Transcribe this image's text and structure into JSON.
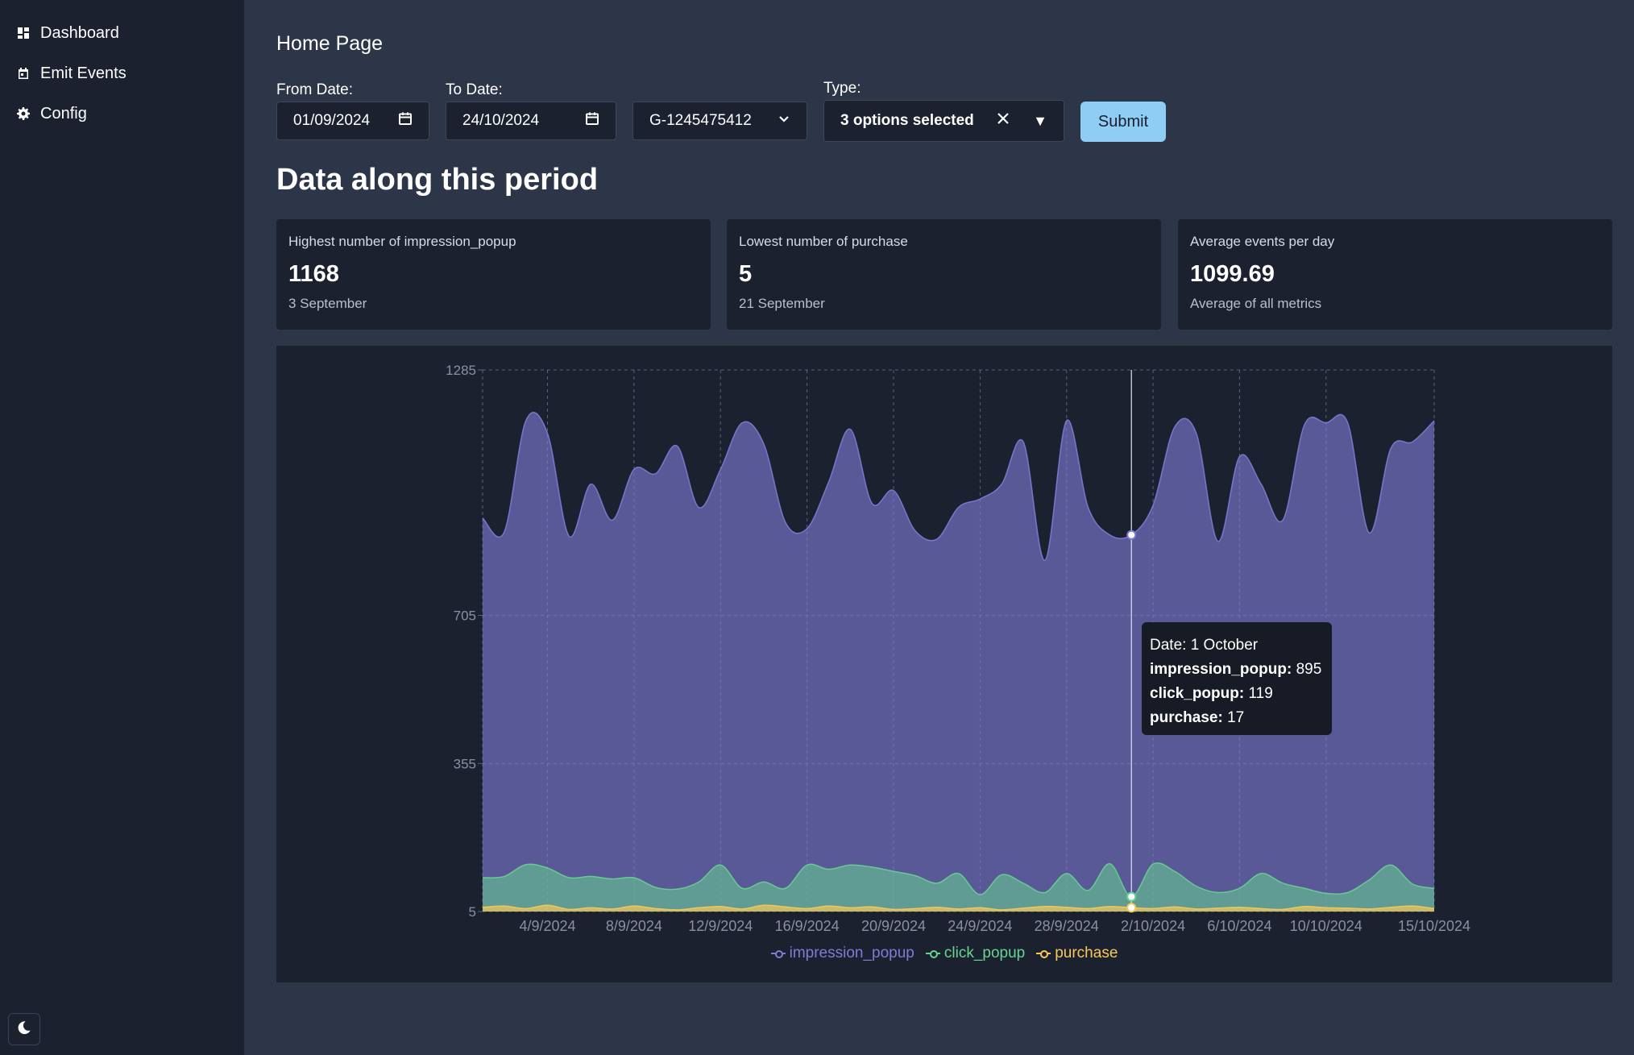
{
  "sidebar": {
    "items": [
      {
        "label": "Dashboard",
        "icon": "dashboard-icon"
      },
      {
        "label": "Emit Events",
        "icon": "calendar-icon"
      },
      {
        "label": "Config",
        "icon": "gear-icon"
      }
    ],
    "theme_toggle_icon": "moon-icon"
  },
  "header": {
    "title": "Home Page"
  },
  "filters": {
    "from_label": "From Date:",
    "from_value": "01/09/2024",
    "to_label": "To Date:",
    "to_value": "24/10/2024",
    "property_value": "G-1245475412",
    "type_label": "Type:",
    "type_value": "3 options selected",
    "submit_label": "Submit"
  },
  "section_title": "Data along this period",
  "stats": [
    {
      "label": "Highest number of impression_popup",
      "value": "1168",
      "help": "3 September"
    },
    {
      "label": "Lowest number of purchase",
      "value": "5",
      "help": "21 September"
    },
    {
      "label": "Average events per day",
      "value": "1099.69",
      "help": "Average of all metrics"
    }
  ],
  "tooltip": {
    "date_line": "Date: 1 October",
    "rows": [
      {
        "key": "impression_popup:",
        "value": " 895"
      },
      {
        "key": "click_popup:",
        "value": " 119"
      },
      {
        "key": "purchase:",
        "value": " 17"
      }
    ]
  },
  "colors": {
    "impression_popup": "#7f7cd6",
    "click_popup": "#68d391",
    "purchase": "#f6c95a",
    "accent": "#90cdf4"
  },
  "chart_data": {
    "type": "area",
    "ylim": [
      5,
      1285
    ],
    "y_ticks": [
      "1285",
      "705",
      "355",
      "5"
    ],
    "x_tick_labels": [
      "4/9/2024",
      "8/9/2024",
      "12/9/2024",
      "16/9/2024",
      "20/9/2024",
      "24/9/2024",
      "28/9/2024",
      "2/10/2024",
      "6/10/2024",
      "10/10/2024",
      "15/10/2024"
    ],
    "x_start": "1/9/2024",
    "grid": true,
    "legend_position": "bottom",
    "series": [
      {
        "name": "impression_popup",
        "values": [
          935,
          902,
          1165,
          1135,
          892,
          1015,
          930,
          1050,
          1040,
          1105,
          960,
          1050,
          1160,
          1110,
          925,
          910,
          1020,
          1145,
          970,
          1000,
          905,
          885,
          960,
          980,
          1015,
          1115,
          835,
          1165,
          960,
          895,
          895,
          965,
          1150,
          1135,
          880,
          1080,
          1015,
          930,
          1155,
          1160,
          1160,
          900,
          1100,
          1115,
          1165
        ]
      },
      {
        "name": "click_popup",
        "values": [
          85,
          88,
          116,
          108,
          85,
          88,
          82,
          85,
          62,
          58,
          75,
          115,
          60,
          75,
          60,
          115,
          105,
          115,
          110,
          100,
          90,
          72,
          95,
          45,
          92,
          72,
          50,
          95,
          55,
          118,
          40,
          117,
          100,
          65,
          50,
          60,
          95,
          72,
          60,
          48,
          50,
          80,
          115,
          70,
          60
        ]
      },
      {
        "name": "purchase",
        "values": [
          15,
          18,
          12,
          20,
          10,
          14,
          11,
          18,
          12,
          9,
          14,
          17,
          11,
          20,
          16,
          12,
          18,
          14,
          16,
          10,
          12,
          15,
          11,
          14,
          9,
          13,
          17,
          15,
          12,
          17,
          14,
          12,
          16,
          11,
          13,
          15,
          12,
          10,
          17,
          14,
          13,
          11,
          15,
          18,
          12
        ]
      }
    ]
  }
}
